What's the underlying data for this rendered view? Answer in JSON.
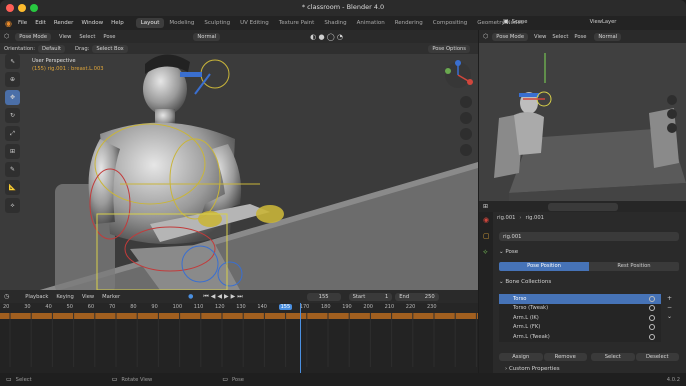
{
  "window": {
    "title": "* classroom - Blender 4.0"
  },
  "menu": {
    "items": [
      "File",
      "Edit",
      "Render",
      "Window",
      "Help"
    ]
  },
  "workspaces": {
    "tabs": [
      "Layout",
      "Modeling",
      "Sculpting",
      "UV Editing",
      "Texture Paint",
      "Shading",
      "Animation",
      "Rendering",
      "Compositing",
      "Geometry Nodes"
    ]
  },
  "scene": {
    "label": "Scene",
    "view_layer": "ViewLayer"
  },
  "viewport_header": {
    "mode": "Pose Mode",
    "view": "View",
    "select": "Select",
    "pose": "Pose",
    "orientation_label": "Orientation:",
    "orientation_value": "Default",
    "drag_label": "Drag:",
    "drag_value": "Select Box",
    "transform": "Normal",
    "pose_options": "Pose Options"
  },
  "viewport_overlay": {
    "perspective": "User Perspective",
    "info": "(155) rig.001 : breast.L.003"
  },
  "right_viewport_header": {
    "mode": "Pose Mode",
    "view": "View",
    "select": "Select",
    "pose": "Pose",
    "transform": "Normal"
  },
  "properties": {
    "breadcrumb_a": "rig.001",
    "breadcrumb_b": "rig.001",
    "object_name": "rig.001",
    "pose_section": "Pose",
    "pose_position": "Pose Position",
    "rest_position": "Rest Position",
    "bone_collections_section": "Bone Collections",
    "bones": [
      "Torso",
      "Torso (Tweak)",
      "Arm.L (IK)",
      "Arm.L (FK)",
      "Arm.L (Tweak)"
    ],
    "assign": "Assign",
    "remove": "Remove",
    "select": "Select",
    "deselect": "Deselect",
    "custom_properties": "Custom Properties"
  },
  "timeline": {
    "playback": "Playback",
    "keying": "Keying",
    "view": "View",
    "marker": "Marker",
    "current_frame": "155",
    "start_label": "Start",
    "start_value": "1",
    "end_label": "End",
    "end_value": "250",
    "ruler": [
      "20",
      "30",
      "40",
      "50",
      "60",
      "70",
      "80",
      "90",
      "100",
      "110",
      "120",
      "130",
      "140",
      "155",
      "170",
      "180",
      "190",
      "200",
      "210",
      "220",
      "230"
    ]
  },
  "status": {
    "select": "Select",
    "rotate": "Rotate View",
    "pose": "Pose",
    "version": "4.0.2"
  },
  "colors": {
    "accent": "#4673b7",
    "bg": "#1d1d1d",
    "viewport": "#3b3b3b",
    "keyframe": "#e0a63a",
    "playhead": "#4a8fe0"
  }
}
